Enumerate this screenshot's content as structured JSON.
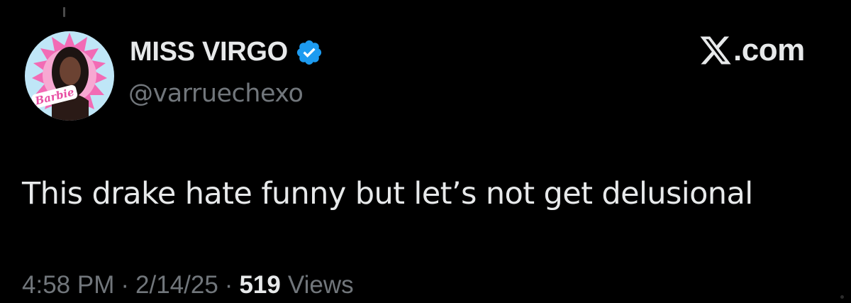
{
  "user": {
    "display_name": "MISS VIRGO",
    "handle": "@varruechexo",
    "avatar_text": "Barbie",
    "verified_color": "#1d9bf0",
    "avatar_accent": "#e84fa3"
  },
  "brand": {
    "text": ".com",
    "icon": "x-logo-icon"
  },
  "tweet": {
    "text": "This drake hate funny but let’s not get delusional"
  },
  "meta": {
    "time": "4:58 PM",
    "separator": "·",
    "date": "2/14/25",
    "views_count": "519",
    "views_label": "Views"
  }
}
